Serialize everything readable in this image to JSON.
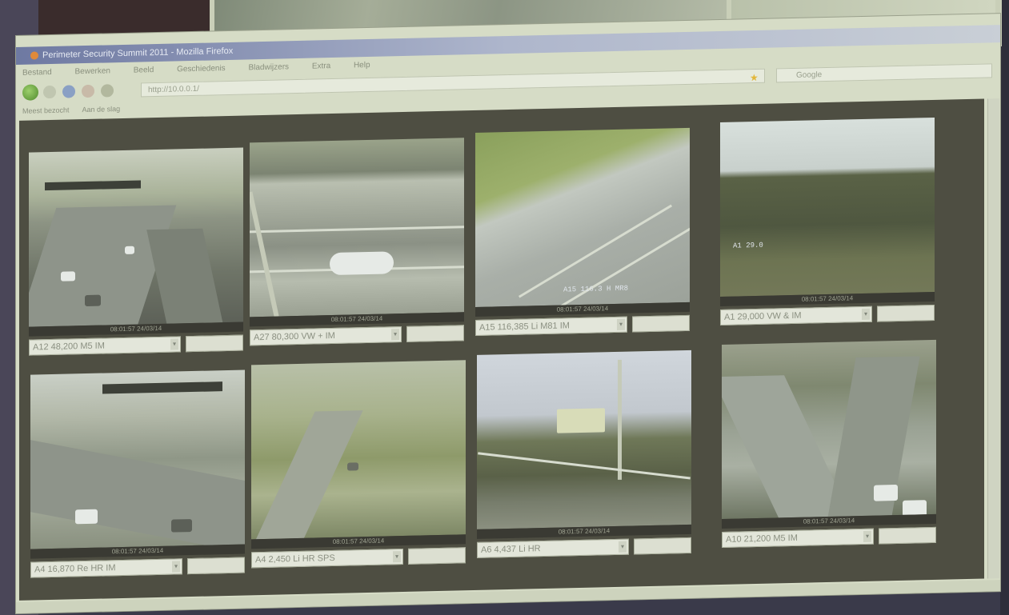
{
  "window": {
    "title": "Perimeter Security Summit 2011 - Mozilla Firefox",
    "menu": [
      "Bestand",
      "Bewerken",
      "Beeld",
      "Geschiedenis",
      "Bladwijzers",
      "Extra",
      "Help"
    ],
    "url": "http://10.0.0.1/",
    "search_placeholder": "Google",
    "bookmarks": [
      "Meest bezocht",
      "Aan de slag"
    ]
  },
  "cameras": [
    {
      "timestamp": "08:01:57 24/03/14",
      "label": "A12 48,200 M5 IM"
    },
    {
      "timestamp": "08:01:57 24/03/14",
      "label": "A27 80,300 VW + IM"
    },
    {
      "timestamp": "08:01:57 24/03/14",
      "label": "A15 116,385 Li M81 IM",
      "overlay": "A15 116.3 H MR8"
    },
    {
      "timestamp": "08:01:57 24/03/14",
      "label": "A1 29,000 VW & IM",
      "overlay": "A1 29.0"
    },
    {
      "timestamp": "08:01:57 24/03/14",
      "label": "A4 16,870 Re HR IM"
    },
    {
      "timestamp": "08:01:57 24/03/14",
      "label": "A4 2,450 Li HR SPS"
    },
    {
      "timestamp": "08:01:57 24/03/14",
      "label": "A6 4,437 Li HR"
    },
    {
      "timestamp": "08:01:57 24/03/14",
      "label": "A10 21,200 M5 IM"
    }
  ]
}
